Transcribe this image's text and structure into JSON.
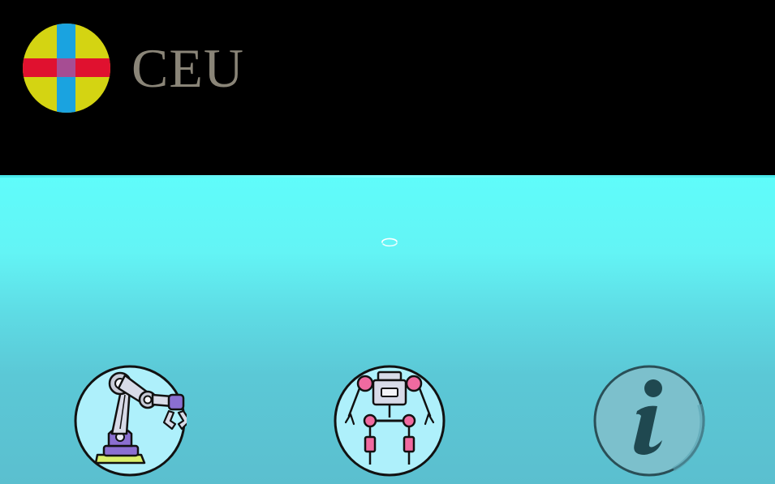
{
  "brand": {
    "name": "CEU",
    "text_color": "#8a8578",
    "logo_colors": {
      "disc": "#d4d412",
      "horizontal_bar": "#e0112f",
      "vertical_bar": "#1aa3e0",
      "center": "#a64d93"
    }
  },
  "scene": {
    "top_color": "#5ffcfb",
    "bottom_color": "#5bbfcf"
  },
  "buttons": [
    {
      "name": "robot-arm",
      "icon": "robotic-arm-icon"
    },
    {
      "name": "humanoid-robot",
      "icon": "robot-skeleton-icon"
    },
    {
      "name": "info",
      "icon": "info-icon"
    }
  ]
}
